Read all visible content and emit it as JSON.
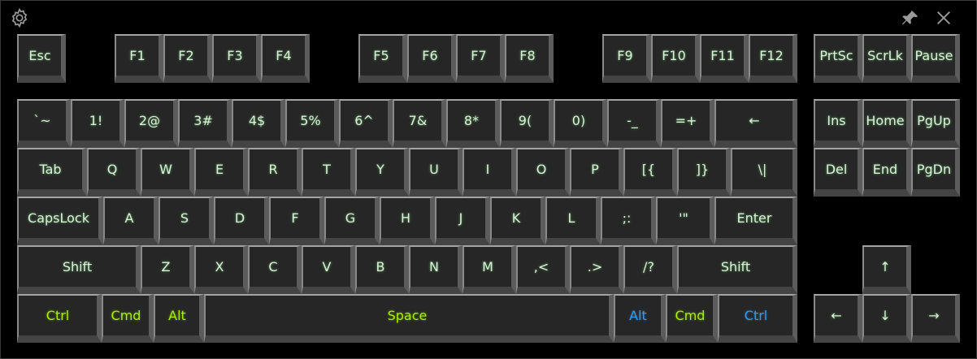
{
  "window": {
    "settings_icon": "gear-icon",
    "pin_icon": "pin-icon",
    "close_icon": "close-icon"
  },
  "colors": {
    "background": "#000000",
    "key_face": "#262626",
    "label_default": "#d9f2d9",
    "label_green": "#a8f000",
    "label_blue": "#2e9cff"
  },
  "rows": {
    "function": [
      {
        "label": "Esc"
      },
      {
        "label": "F1"
      },
      {
        "label": "F2"
      },
      {
        "label": "F3"
      },
      {
        "label": "F4"
      },
      {
        "label": "F5"
      },
      {
        "label": "F6"
      },
      {
        "label": "F7"
      },
      {
        "label": "F8"
      },
      {
        "label": "F9"
      },
      {
        "label": "F10"
      },
      {
        "label": "F11"
      },
      {
        "label": "F12"
      },
      {
        "label": "PrtSc"
      },
      {
        "label": "ScrLk"
      },
      {
        "label": "Pause"
      }
    ],
    "number": [
      {
        "label": "`~"
      },
      {
        "label": "1!"
      },
      {
        "label": "2@"
      },
      {
        "label": "3#"
      },
      {
        "label": "4$"
      },
      {
        "label": "5%"
      },
      {
        "label": "6^"
      },
      {
        "label": "7&"
      },
      {
        "label": "8*"
      },
      {
        "label": "9("
      },
      {
        "label": "0)"
      },
      {
        "label": "-_"
      },
      {
        "label": "=+"
      },
      {
        "label": "←"
      },
      {
        "label": "Ins"
      },
      {
        "label": "Home"
      },
      {
        "label": "PgUp"
      }
    ],
    "top_alpha": [
      {
        "label": "Tab"
      },
      {
        "label": "Q"
      },
      {
        "label": "W"
      },
      {
        "label": "E"
      },
      {
        "label": "R"
      },
      {
        "label": "T"
      },
      {
        "label": "Y"
      },
      {
        "label": "U"
      },
      {
        "label": "I"
      },
      {
        "label": "O"
      },
      {
        "label": "P"
      },
      {
        "label": "[{"
      },
      {
        "label": "]}"
      },
      {
        "label": "\\|"
      },
      {
        "label": "Del"
      },
      {
        "label": "End"
      },
      {
        "label": "PgDn"
      }
    ],
    "home_alpha": [
      {
        "label": "CapsLock"
      },
      {
        "label": "A"
      },
      {
        "label": "S"
      },
      {
        "label": "D"
      },
      {
        "label": "F"
      },
      {
        "label": "G"
      },
      {
        "label": "H"
      },
      {
        "label": "J"
      },
      {
        "label": "K"
      },
      {
        "label": "L"
      },
      {
        "label": ";:"
      },
      {
        "label": "'\""
      },
      {
        "label": "Enter"
      }
    ],
    "bottom_alpha": [
      {
        "label": "Shift"
      },
      {
        "label": "Z"
      },
      {
        "label": "X"
      },
      {
        "label": "C"
      },
      {
        "label": "V"
      },
      {
        "label": "B"
      },
      {
        "label": "N"
      },
      {
        "label": "M"
      },
      {
        "label": ",<"
      },
      {
        "label": ".>"
      },
      {
        "label": "/?"
      },
      {
        "label": "Shift"
      },
      {
        "label": "↑"
      }
    ],
    "modifiers": [
      {
        "label": "Ctrl",
        "color": "green"
      },
      {
        "label": "Cmd",
        "color": "green"
      },
      {
        "label": "Alt",
        "color": "green"
      },
      {
        "label": "Space",
        "color": "green"
      },
      {
        "label": "Alt",
        "color": "blue"
      },
      {
        "label": "Cmd",
        "color": "green"
      },
      {
        "label": "Ctrl",
        "color": "blue"
      },
      {
        "label": "←",
        "color": "default"
      },
      {
        "label": "↓",
        "color": "default"
      },
      {
        "label": "→",
        "color": "default"
      }
    ]
  }
}
